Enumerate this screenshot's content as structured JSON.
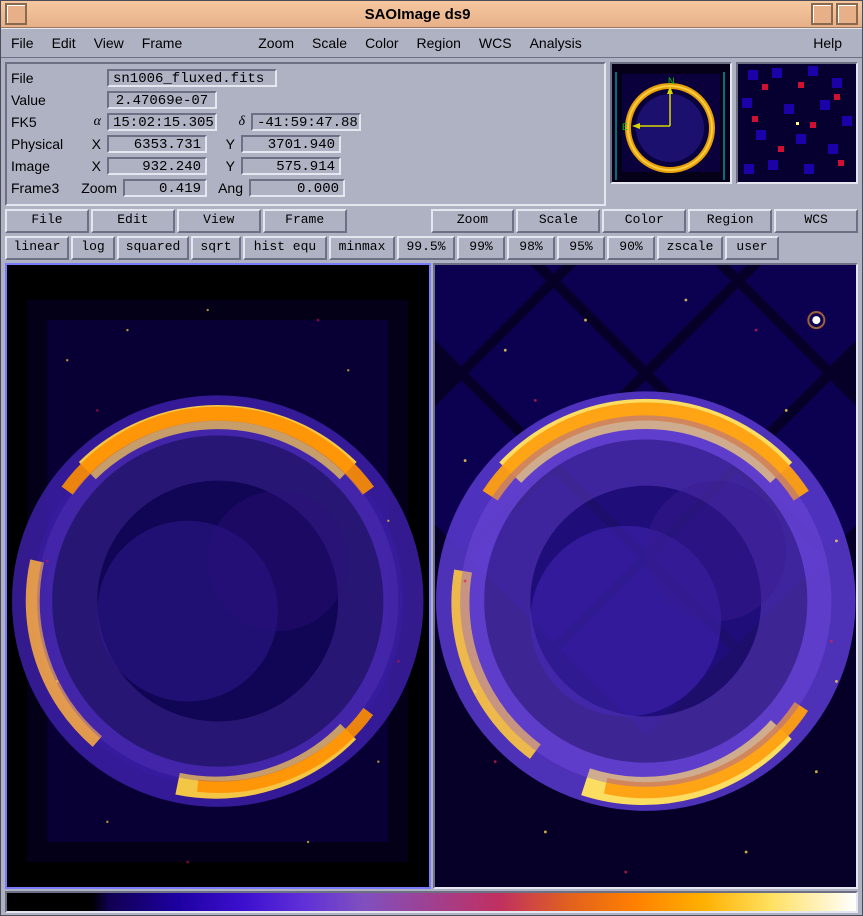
{
  "title": "SAOImage ds9",
  "menu": {
    "file": "File",
    "edit": "Edit",
    "view": "View",
    "frame": "Frame",
    "zoom": "Zoom",
    "scale": "Scale",
    "color": "Color",
    "region": "Region",
    "wcs": "WCS",
    "analysis": "Analysis",
    "help": "Help"
  },
  "info": {
    "file_label": "File",
    "file_value": "sn1006_fluxed.fits",
    "value_label": "Value",
    "value_value": "2.47069e-07",
    "fk5_label": "FK5",
    "alpha_sym": "α",
    "alpha_value": "15:02:15.305",
    "delta_sym": "δ",
    "delta_value": "-41:59:47.88",
    "phys_label": "Physical",
    "x_sym": "X",
    "phys_x": "6353.731",
    "y_sym": "Y",
    "phys_y": "3701.940",
    "image_label": "Image",
    "image_x": "932.240",
    "image_y": "575.914",
    "frame_label": "Frame3",
    "zoom_sym": "Zoom",
    "zoom_value": "0.419",
    "ang_sym": "Ang",
    "ang_value": "0.000"
  },
  "btnrow1": {
    "file": "File",
    "edit": "Edit",
    "view": "View",
    "frame": "Frame",
    "zoom": "Zoom",
    "scale": "Scale",
    "color": "Color",
    "region": "Region",
    "wcs": "WCS"
  },
  "btnrow2": {
    "linear": "linear",
    "log": "log",
    "squared": "squared",
    "sqrt": "sqrt",
    "hist": "hist equ",
    "minmax": "minmax",
    "p995": "99.5%",
    "p99": "99%",
    "p98": "98%",
    "p95": "95%",
    "p90": "90%",
    "zscale": "zscale",
    "user": "user"
  },
  "compass": {
    "n": "N",
    "e": "E"
  }
}
